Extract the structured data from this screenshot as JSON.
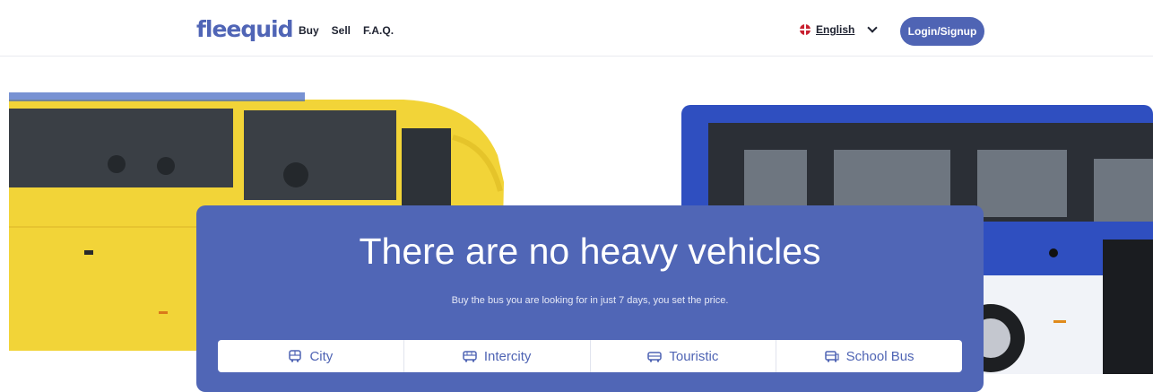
{
  "header": {
    "logo": "fleequid",
    "nav": [
      "Buy",
      "Sell",
      "F.A.Q."
    ],
    "language": "English",
    "login_label": "Login/Signup"
  },
  "hero": {
    "title": "There are no heavy vehicles",
    "subtitle": "Buy the bus you are looking for in just 7 days, you set the price."
  },
  "categories": [
    {
      "label": "City",
      "icon": "city-bus-icon"
    },
    {
      "label": "Intercity",
      "icon": "intercity-bus-icon"
    },
    {
      "label": "Touristic",
      "icon": "touristic-bus-icon"
    },
    {
      "label": "School Bus",
      "icon": "school-bus-icon"
    }
  ],
  "colors": {
    "brand": "#4f64b4",
    "panel": "#5066b6",
    "bus_yellow": "#f4d63a",
    "bus_blue": "#2f4fc0"
  }
}
